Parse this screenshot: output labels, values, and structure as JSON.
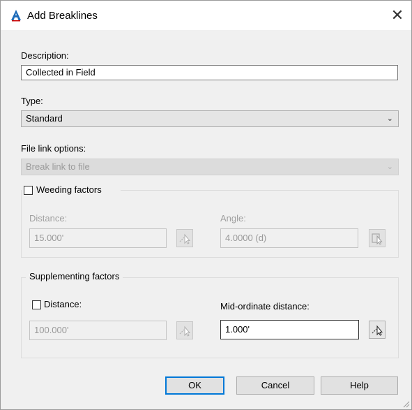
{
  "window": {
    "title": "Add Breaklines",
    "close_glyph": "✕",
    "app_icon": "autocad-a-icon"
  },
  "description": {
    "label": "Description:",
    "value": "Collected in Field"
  },
  "type": {
    "label": "Type:",
    "value": "Standard"
  },
  "file_link": {
    "label": "File link options:",
    "value": "Break link to file"
  },
  "weeding": {
    "label": "Weeding factors",
    "checked": false,
    "distance_label": "Distance:",
    "distance_value": "15.000'",
    "angle_label": "Angle:",
    "angle_value": "4.0000 (d)"
  },
  "supplementing": {
    "label": "Supplementing factors",
    "distance_label": "Distance:",
    "distance_checked": false,
    "distance_value": "100.000'",
    "midord_label": "Mid-ordinate distance:",
    "midord_value": "1.000'"
  },
  "buttons": {
    "ok": "OK",
    "cancel": "Cancel",
    "help": "Help"
  },
  "colors": {
    "accent": "#0078d7",
    "dialog_bg": "#f0f0f0",
    "disabled_text": "#a0a0a0"
  }
}
